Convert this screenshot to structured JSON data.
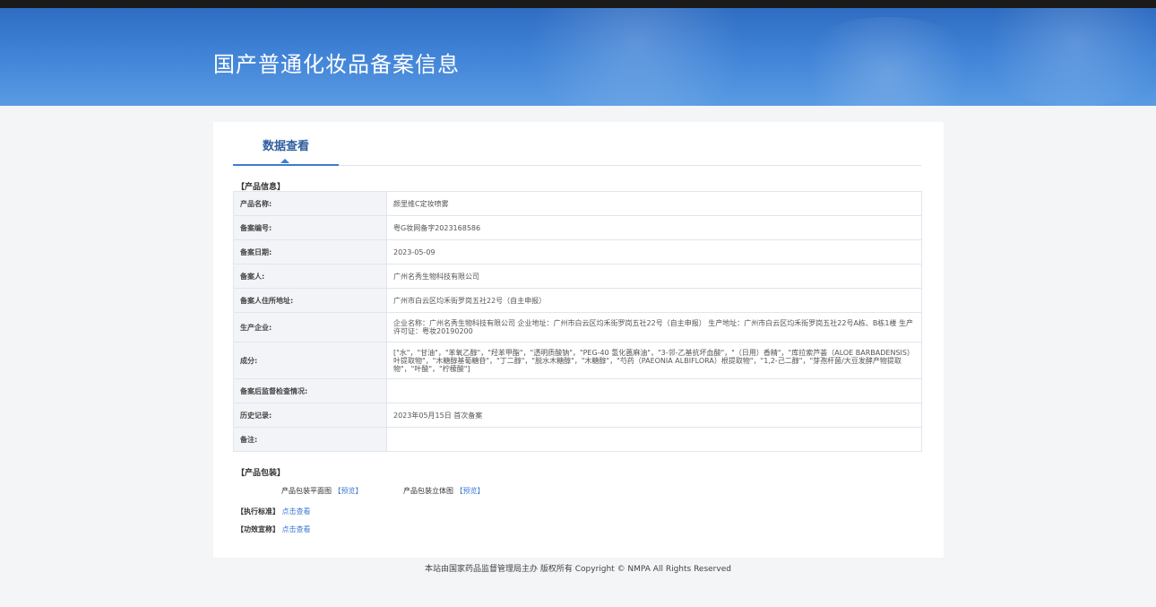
{
  "banner": {
    "title": "国产普通化妆品备案信息"
  },
  "tabs": [
    {
      "label": "数据查看"
    }
  ],
  "product_info": {
    "section_label": "【产品信息】",
    "rows": [
      {
        "key": "产品名称:",
        "value": "颜里维C定妆喷雾"
      },
      {
        "key": "备案编号:",
        "value": "粤G妆网备字2023168586"
      },
      {
        "key": "备案日期:",
        "value": "2023-05-09"
      },
      {
        "key": "备案人:",
        "value": "广州名秀生物科技有限公司"
      },
      {
        "key": "备案人住所地址:",
        "value": "广州市白云区均禾街罗岗五社22号（自主申报）"
      },
      {
        "key": "生产企业:",
        "value": "企业名称：广州名秀生物科技有限公司 企业地址：广州市白云区均禾街罗岗五社22号（自主申报） 生产地址：广州市白云区均禾街罗岗五社22号A栋、B栋1楼 生产许可证：粤妆20190200"
      },
      {
        "key": "成分:",
        "value": "[\"水\"，\"甘油\"，\"苯氧乙醇\"，\"羟苯甲酯\"，\"透明质酸钠\"，\"PEG-40 氢化蓖麻油\"，\"3-邻-乙基抗坏血酸\"，\"（日用）香精\"，\"库拉索芦荟（ALOE BARBADENSIS）叶提取物\"，\"木糖醇基葡糖苷\"，\"丁二醇\"，\"脱水木糖醇\"，\"木糖醇\"，\"芍药（PAEONIA ALBIFLORA）根提取物\"，\"1,2-己二醇\"，\"芽孢杆菌/大豆发酵产物提取物\"，\"叶酸\"，\"柠檬酸\"]"
      },
      {
        "key": "备案后监督检查情况:",
        "value": ""
      },
      {
        "key": "历史记录:",
        "value": "2023年05月15日 首次备案"
      },
      {
        "key": "备注:",
        "value": ""
      }
    ]
  },
  "packaging": {
    "section_label": "【产品包装】",
    "flat_label": "产品包装平面图",
    "flat_link": "【预览】",
    "stereo_label": "产品包装立体图",
    "stereo_link": "【预览】"
  },
  "standard": {
    "label": "【执行标准】",
    "link": "点击查看"
  },
  "efficacy": {
    "label": "【功效宣称】",
    "link": "点击查看"
  },
  "footer": {
    "text": "本站由国家药品监督管理局主办 版权所有 Copyright © NMPA All Rights Reserved"
  },
  "colors": {
    "banner_top": "#2e6cc2",
    "banner_bottom": "#5a9be3",
    "accent": "#3d7dd0",
    "link": "#3b7ad3",
    "table_border": "#a8c4e3",
    "key_bg": "#f2f4f7"
  }
}
